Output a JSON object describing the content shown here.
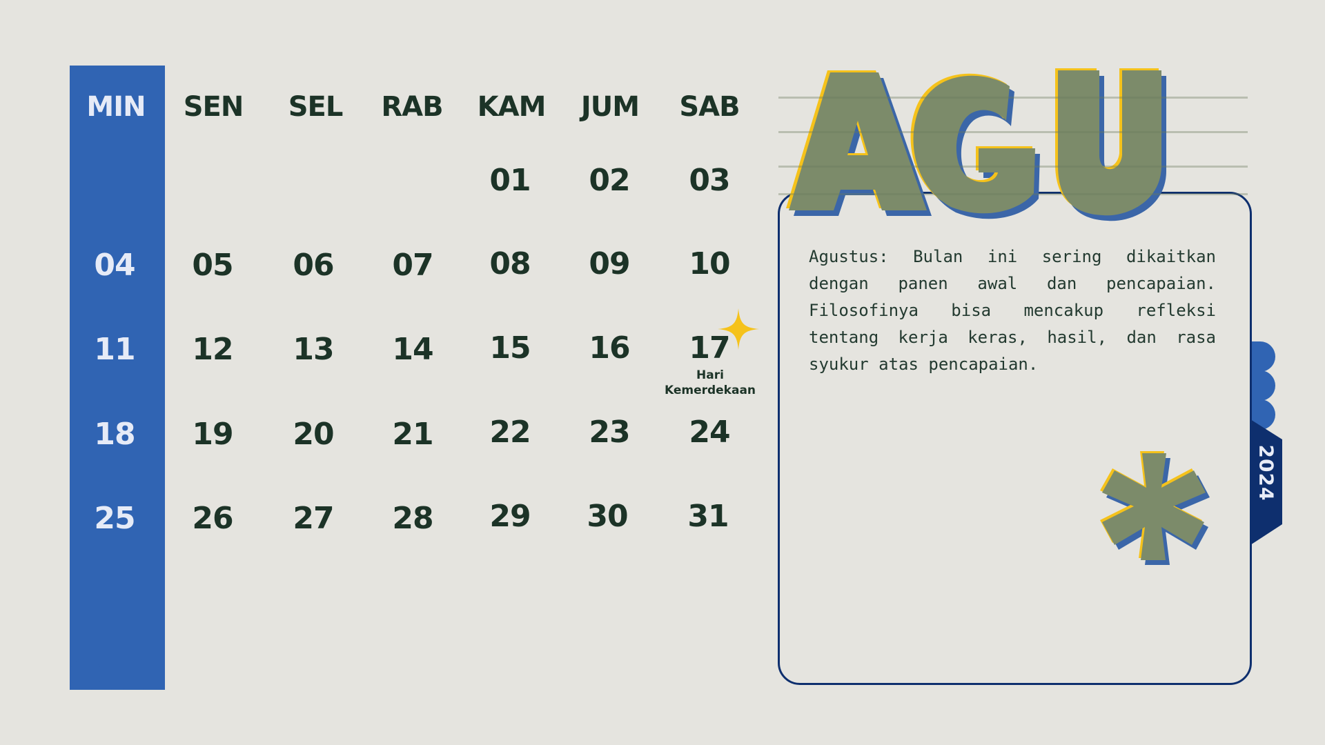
{
  "calendar": {
    "day_names": [
      "MIN",
      "SEN",
      "SEL",
      "RAB",
      "KAM",
      "JUM",
      "SAB"
    ],
    "weeks": [
      [
        "",
        "",
        "",
        "",
        "01",
        "02",
        "03"
      ],
      [
        "04",
        "05",
        "06",
        "07",
        "08",
        "09",
        "10"
      ],
      [
        "11",
        "12",
        "13",
        "14",
        "15",
        "16",
        "17"
      ],
      [
        "18",
        "19",
        "20",
        "21",
        "22",
        "23",
        "24"
      ],
      [
        "25",
        "26",
        "27",
        "28",
        "29",
        "30",
        "31"
      ]
    ],
    "holiday_note": "Hari Kemerdekaan"
  },
  "month": {
    "abbr": "AGU",
    "year": "2024",
    "description": "Agustus: Bulan ini sering dikaitkan dengan panen awal dan pencapaian. Filosofinya bisa mencakup refleksi tentang kerja keras, hasil, dan rasa syukur atas pencapaian."
  },
  "colors": {
    "background": "#e5e4df",
    "sunday_strip": "#3064b3",
    "text_dark": "#1c3327",
    "box_border": "#0e2f6e",
    "year_tab": "#0e2f6e",
    "letters_fill": "#7c8b6a",
    "accent_yellow": "#f5c21b"
  },
  "icons": [
    "sparkle-icon",
    "asterisk-decoration"
  ]
}
